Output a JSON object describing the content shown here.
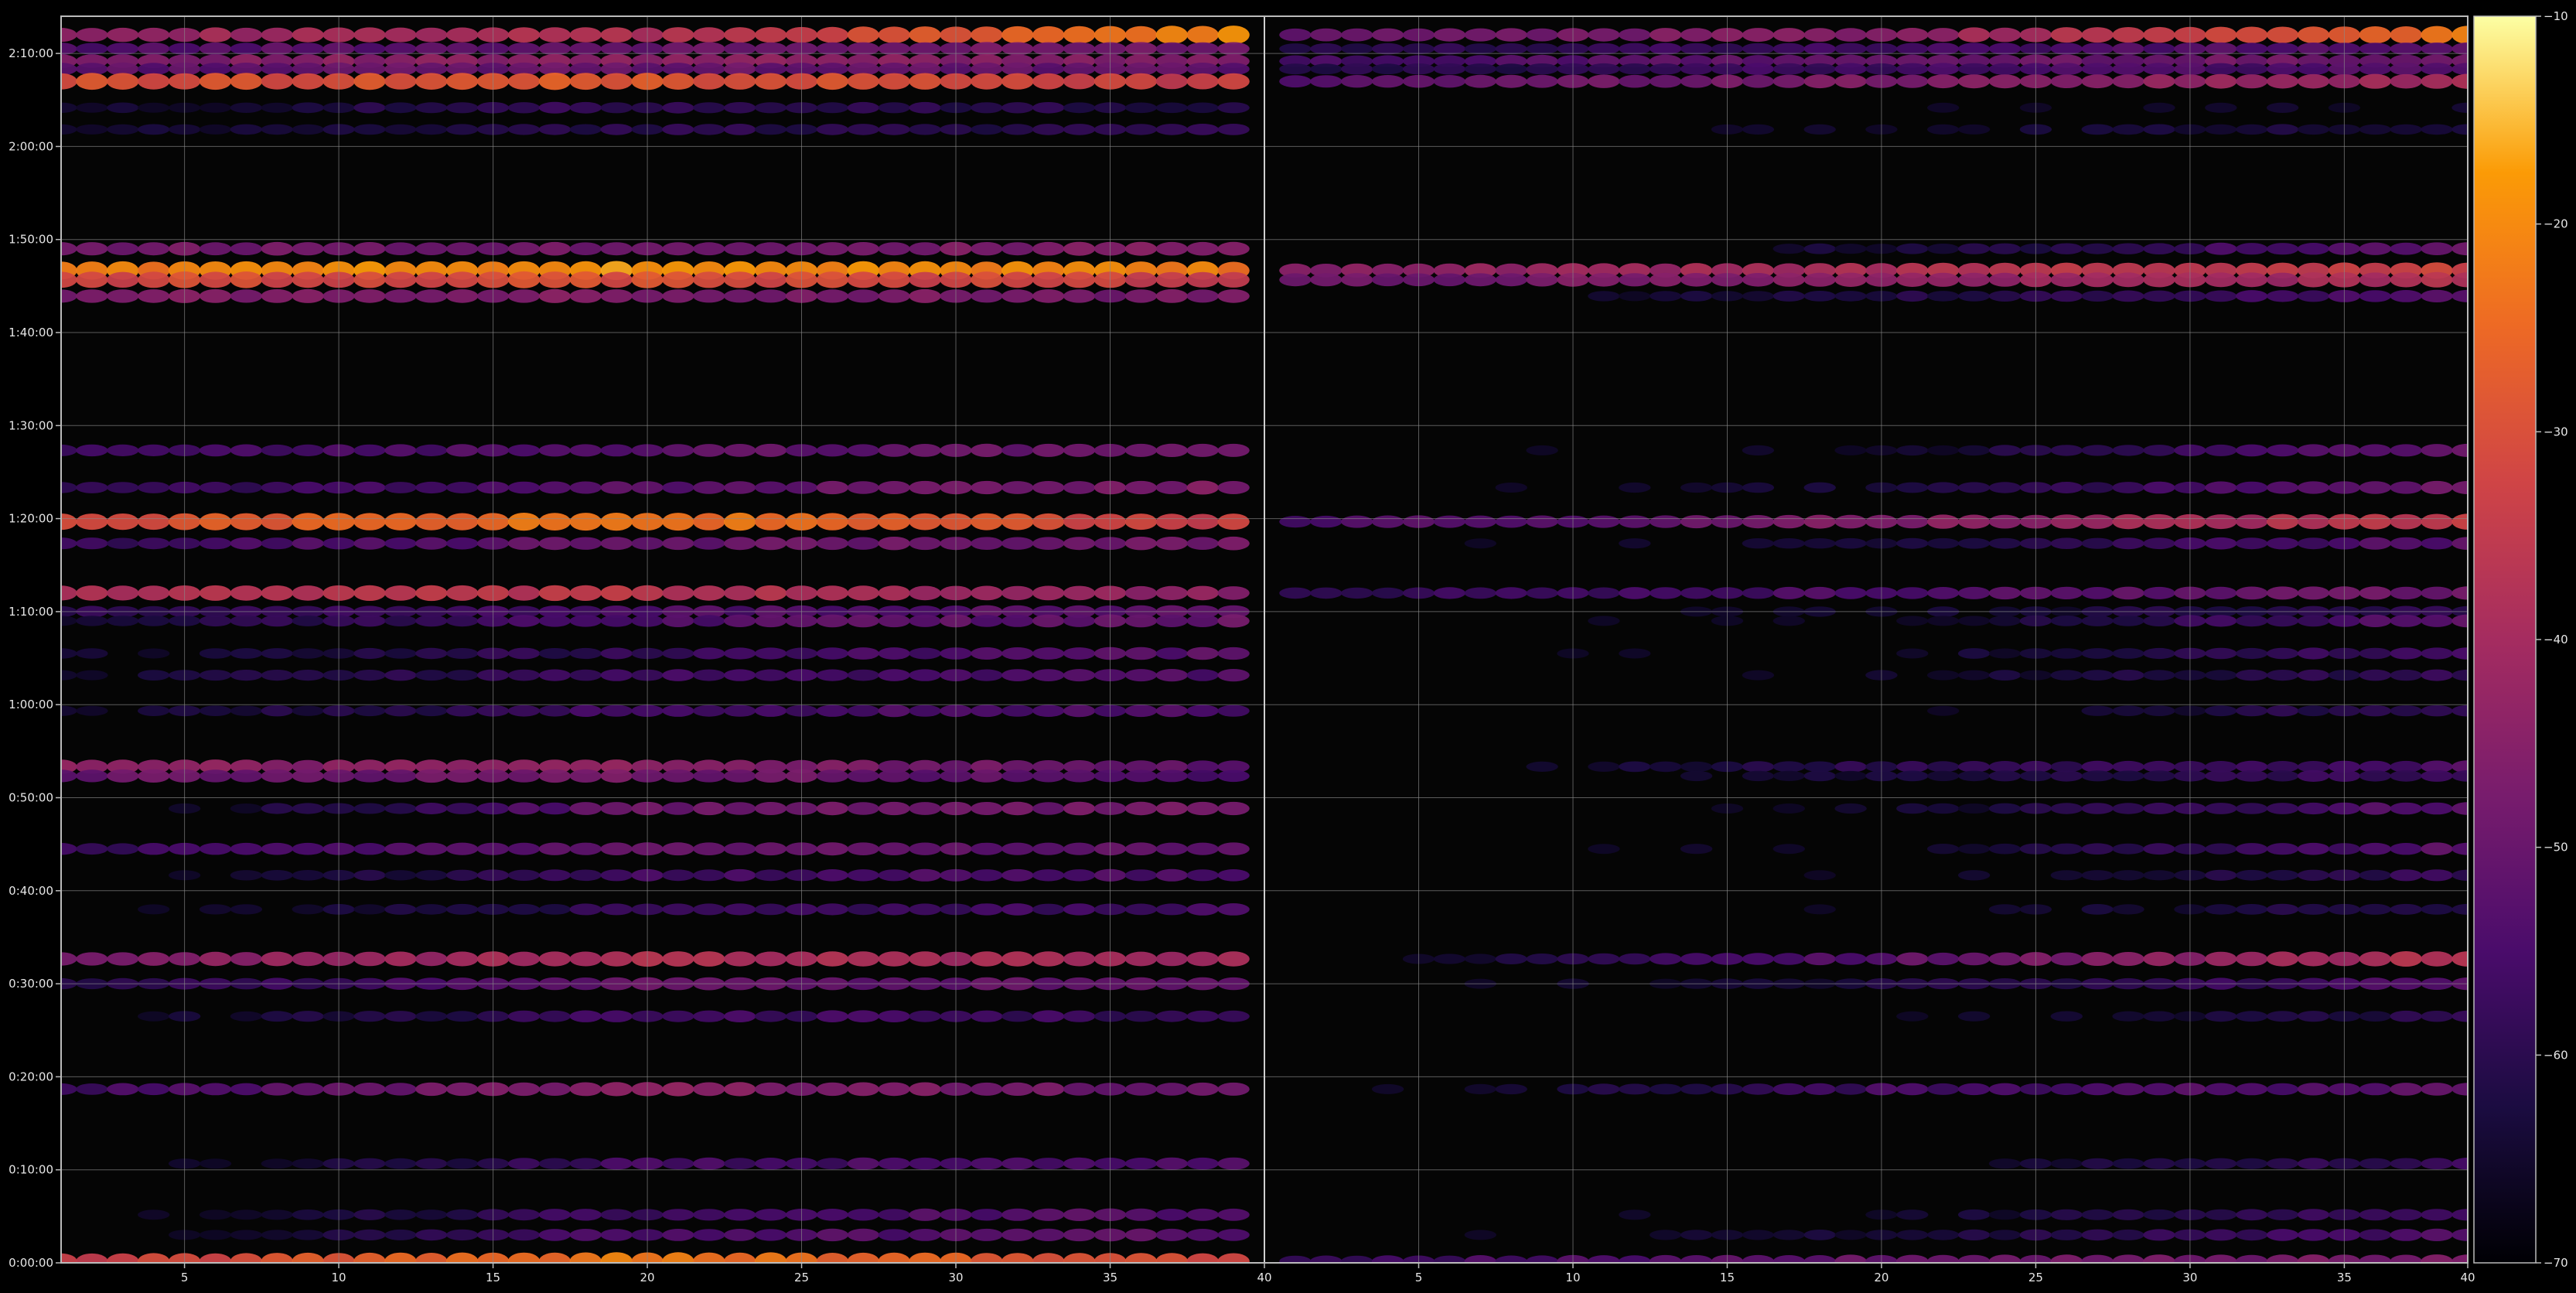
{
  "figure": {
    "background": "#000000",
    "axes_facecolor": "#050505",
    "grid": true,
    "grid_color": "#8a8a8a",
    "spine_color": "#bbbbbb",
    "colormap": "inferno"
  },
  "chart_data": {
    "type": "heatmap",
    "title": "",
    "xlabel": "",
    "ylabel": "",
    "layout": "two side-by-side panels sharing the time axis",
    "xlim": [
      1,
      79
    ],
    "x_ticks": [
      5,
      10,
      15,
      20,
      25,
      30,
      35,
      40,
      45,
      50,
      55,
      60,
      65,
      70,
      75,
      79
    ],
    "x_tick_labels": [
      "5",
      "10",
      "15",
      "20",
      "25",
      "30",
      "35",
      "40",
      "5",
      "10",
      "15",
      "20",
      "25",
      "30",
      "35",
      "40"
    ],
    "y_unit_seconds": true,
    "ylim": [
      0,
      8040
    ],
    "y_ticks": [
      0,
      600,
      1200,
      1800,
      2400,
      3000,
      3600,
      4200,
      4800,
      5400,
      6000,
      6600,
      7200,
      7800
    ],
    "y_tick_labels": [
      "0:00:00",
      "0:10:00",
      "0:20:00",
      "0:30:00",
      "0:40:00",
      "0:50:00",
      "1:00:00",
      "1:10:00",
      "1:20:00",
      "1:30:00",
      "1:40:00",
      "1:50:00",
      "2:00:00",
      "2:10:00"
    ],
    "colorbar": {
      "range": [
        -70,
        -10
      ],
      "ticks": [
        -70,
        -60,
        -50,
        -40,
        -30,
        -20,
        -10
      ],
      "tick_labels": [
        "−70",
        "−60",
        "−50",
        "−40",
        "−30",
        "−20",
        "−10"
      ]
    },
    "divider_x": 40,
    "bands": [
      {
        "time": 7920,
        "left": [
          -42,
          -38,
          -20
        ],
        "right": [
          -50,
          -44,
          -22
        ]
      },
      {
        "time": 7830,
        "left": [
          -54,
          -50,
          -48
        ],
        "right": [
          -60,
          -56,
          -52
        ]
      },
      {
        "time": 7750,
        "left": [
          -46,
          -44,
          -45
        ],
        "right": [
          -56,
          -50,
          -48
        ]
      },
      {
        "time": 7700,
        "left": [
          -52,
          -50,
          -52
        ],
        "right": [
          -62,
          -56,
          -54
        ]
      },
      {
        "time": 7620,
        "left": [
          -30,
          -28,
          -34
        ],
        "right": [
          -52,
          -46,
          -40
        ]
      },
      {
        "time": 7450,
        "left": [
          -66,
          -58,
          -62
        ],
        "right": [
          -70,
          -68,
          -66
        ]
      },
      {
        "time": 7310,
        "left": [
          -66,
          -60,
          -60
        ],
        "right": [
          -70,
          -66,
          -62
        ]
      },
      {
        "time": 6540,
        "left": [
          -48,
          -48,
          -46
        ],
        "right": [
          -70,
          -64,
          -50
        ]
      },
      {
        "time": 6400,
        "left": [
          -22,
          -18,
          -22
        ],
        "right": [
          -46,
          -38,
          -32
        ]
      },
      {
        "time": 6340,
        "left": [
          -32,
          -30,
          -34
        ],
        "right": [
          -50,
          -44,
          -38
        ]
      },
      {
        "time": 6235,
        "left": [
          -46,
          -46,
          -48
        ],
        "right": [
          -70,
          -62,
          -54
        ]
      },
      {
        "time": 5240,
        "left": [
          -58,
          -52,
          -48
        ],
        "right": [
          -70,
          -66,
          -50
        ]
      },
      {
        "time": 5000,
        "left": [
          -60,
          -52,
          -46
        ],
        "right": [
          -70,
          -64,
          -48
        ]
      },
      {
        "time": 4780,
        "left": [
          -30,
          -22,
          -34
        ],
        "right": [
          -56,
          -46,
          -34
        ]
      },
      {
        "time": 4640,
        "left": [
          -58,
          -50,
          -48
        ],
        "right": [
          -70,
          -64,
          -52
        ]
      },
      {
        "time": 4320,
        "left": [
          -38,
          -36,
          -44
        ],
        "right": [
          -60,
          -54,
          -48
        ]
      },
      {
        "time": 4200,
        "left": [
          -60,
          -54,
          -52
        ],
        "right": [
          -70,
          -66,
          -58
        ]
      },
      {
        "time": 4140,
        "left": [
          -64,
          -54,
          -50
        ],
        "right": [
          -70,
          -66,
          -52
        ]
      },
      {
        "time": 3930,
        "left": [
          -66,
          -58,
          -52
        ],
        "right": [
          -70,
          -66,
          -56
        ]
      },
      {
        "time": 3790,
        "left": [
          -66,
          -56,
          -54
        ],
        "right": [
          -70,
          -66,
          -58
        ]
      },
      {
        "time": 3560,
        "left": [
          -66,
          -56,
          -54
        ],
        "right": [
          -70,
          -68,
          -58
        ]
      },
      {
        "time": 3200,
        "left": [
          -44,
          -44,
          -52
        ],
        "right": [
          -70,
          -60,
          -54
        ]
      },
      {
        "time": 3140,
        "left": [
          -50,
          -48,
          -54
        ],
        "right": [
          -70,
          -64,
          -56
        ]
      },
      {
        "time": 2930,
        "left": [
          -70,
          -50,
          -48
        ],
        "right": [
          -70,
          -66,
          -52
        ]
      },
      {
        "time": 2670,
        "left": [
          -58,
          -50,
          -52
        ],
        "right": [
          -70,
          -66,
          -52
        ]
      },
      {
        "time": 2500,
        "left": [
          -70,
          -56,
          -54
        ],
        "right": [
          -70,
          -68,
          -58
        ]
      },
      {
        "time": 2280,
        "left": [
          -70,
          -58,
          -56
        ],
        "right": [
          -70,
          -68,
          -60
        ]
      },
      {
        "time": 1960,
        "left": [
          -46,
          -38,
          -40
        ],
        "right": [
          -70,
          -52,
          -36
        ]
      },
      {
        "time": 1800,
        "left": [
          -62,
          -50,
          -52
        ],
        "right": [
          -70,
          -62,
          -54
        ]
      },
      {
        "time": 1590,
        "left": [
          -68,
          -56,
          -58
        ],
        "right": [
          -70,
          -68,
          -60
        ]
      },
      {
        "time": 1120,
        "left": [
          -56,
          -44,
          -50
        ],
        "right": [
          -70,
          -56,
          -52
        ]
      },
      {
        "time": 640,
        "left": [
          -70,
          -56,
          -54
        ],
        "right": [
          -70,
          -68,
          -56
        ]
      },
      {
        "time": 310,
        "left": [
          -70,
          -56,
          -52
        ],
        "right": [
          -70,
          -66,
          -54
        ]
      },
      {
        "time": 180,
        "left": [
          -70,
          -54,
          -52
        ],
        "right": [
          -70,
          -64,
          -54
        ]
      },
      {
        "time": 10,
        "left": [
          -34,
          -22,
          -30
        ],
        "right": [
          -58,
          -50,
          -46
        ]
      }
    ]
  }
}
